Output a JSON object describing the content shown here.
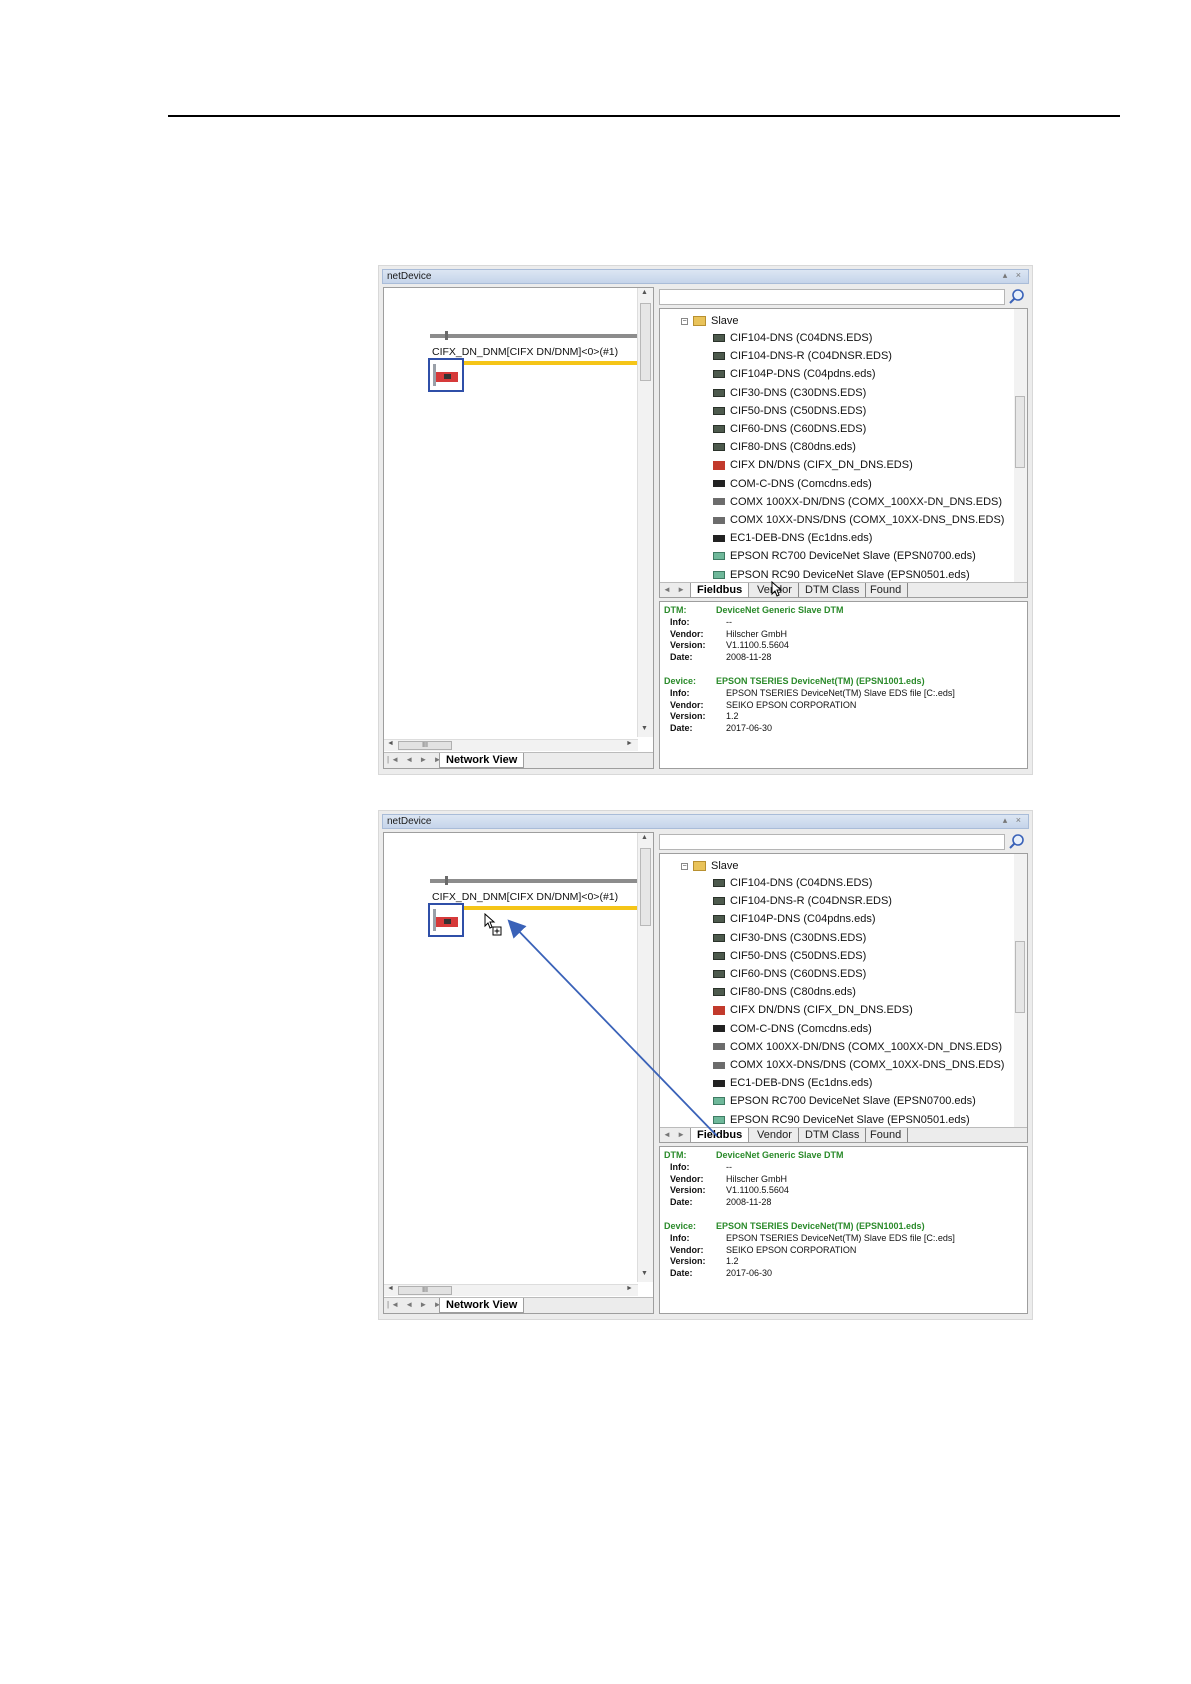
{
  "window_title": "netDevice",
  "title_buttons": "▴ ×",
  "network": {
    "device_label": "CIFX_DN_DNM[CIFX DN/DNM]<0>(#1)",
    "tab_label": "Network View",
    "hscroll_thumb": "III"
  },
  "catalog": {
    "folder": "Slave",
    "items": [
      {
        "label": "CIF104-DNS (C04DNS.EDS)",
        "icon": "board"
      },
      {
        "label": "CIF104-DNS-R (C04DNSR.EDS)",
        "icon": "board"
      },
      {
        "label": "CIF104P-DNS (C04pdns.eds)",
        "icon": "board"
      },
      {
        "label": "CIF30-DNS (C30DNS.EDS)",
        "icon": "board"
      },
      {
        "label": "CIF50-DNS (C50DNS.EDS)",
        "icon": "board"
      },
      {
        "label": "CIF60-DNS (C60DNS.EDS)",
        "icon": "board"
      },
      {
        "label": "CIF80-DNS (C80dns.eds)",
        "icon": "board"
      },
      {
        "label": "CIFX DN/DNS (CIFX_DN_DNS.EDS)",
        "icon": "red"
      },
      {
        "label": "COM-C-DNS (Comcdns.eds)",
        "icon": "black"
      },
      {
        "label": "COMX 100XX-DN/DNS (COMX_100XX-DN_DNS.EDS)",
        "icon": "gray"
      },
      {
        "label": "COMX 10XX-DNS/DNS (COMX_10XX-DNS_DNS.EDS)",
        "icon": "gray"
      },
      {
        "label": "EC1-DEB-DNS (Ec1dns.eds)",
        "icon": "black"
      },
      {
        "label": "EPSON RC700 DeviceNet Slave (EPSN0700.eds)",
        "icon": "green"
      },
      {
        "label": "EPSON RC90 DeviceNet Slave (EPSN0501.eds)",
        "icon": "green"
      },
      {
        "label": "EPSON TSERIES DeviceNet(TM) (EPSN1001.eds)",
        "icon": "green",
        "selected": true
      }
    ],
    "tabs": [
      "Fieldbus",
      "Vendor",
      "DTM Class",
      "Found"
    ]
  },
  "info": {
    "dtm_label": "DTM:",
    "dtm_value": "DeviceNet Generic Slave DTM",
    "dtm_rows": [
      {
        "label": "Info:",
        "value": "--"
      },
      {
        "label": "Vendor:",
        "value": "Hilscher GmbH"
      },
      {
        "label": "Version:",
        "value": "V1.1100.5.5604"
      },
      {
        "label": "Date:",
        "value": "2008-11-28"
      }
    ],
    "device_label": "Device:",
    "device_value": "EPSON TSERIES DeviceNet(TM) (EPSN1001.eds)",
    "device_rows": [
      {
        "label": "Info:",
        "value": "EPSON TSERIES DeviceNet(TM) Slave EDS file [C:.eds]"
      },
      {
        "label": "Vendor:",
        "value": "SEIKO EPSON CORPORATION"
      },
      {
        "label": "Version:",
        "value": "1.2"
      },
      {
        "label": "Date:",
        "value": "2017-06-30"
      }
    ]
  },
  "colors": {
    "accent_selection": "#3d7bd6",
    "bus_yellow": "#f5c518",
    "info_green": "#2a8a2a",
    "drag_arrow": "#3a62b8"
  }
}
